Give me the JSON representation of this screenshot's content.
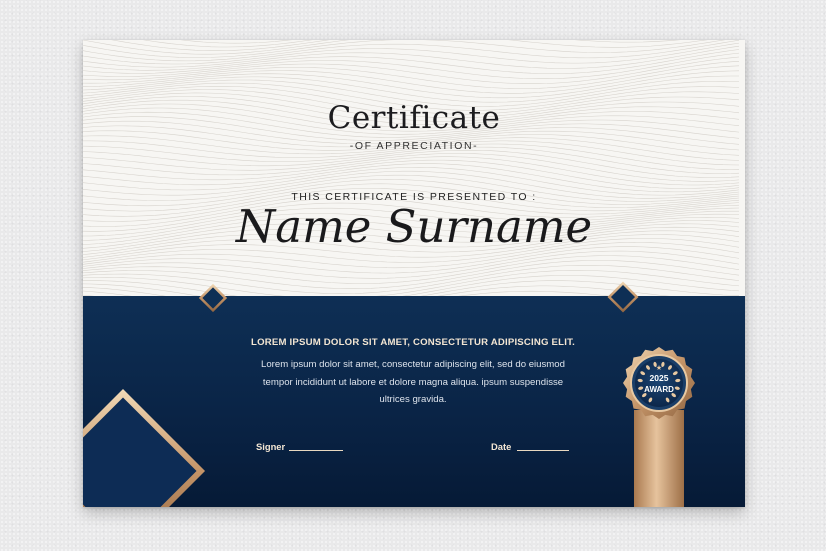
{
  "certificate": {
    "title": "Certificate",
    "subtitle": "-OF APPRECIATION-",
    "presented_to": "THIS CERTIFICATE IS PRESENTED TO :",
    "recipient_name": "Name Surname",
    "heading": "LOREM IPSUM DOLOR SIT AMET, CONSECTETUR ADIPISCING ELIT.",
    "body": "Lorem ipsum dolor sit amet, consectetur adipiscing elit, sed do eiusmod tempor incididunt ut labore et dolore magna aliqua. ipsum suspendisse ultrices gravida.",
    "signer_label": "Signer",
    "date_label": "Date"
  },
  "seal": {
    "year": "2025",
    "label": "AWARD"
  },
  "colors": {
    "navy": "#0a2446",
    "gold": "#c9a27a",
    "paper": "#f7f6f3",
    "background": "#e9e9ea"
  }
}
